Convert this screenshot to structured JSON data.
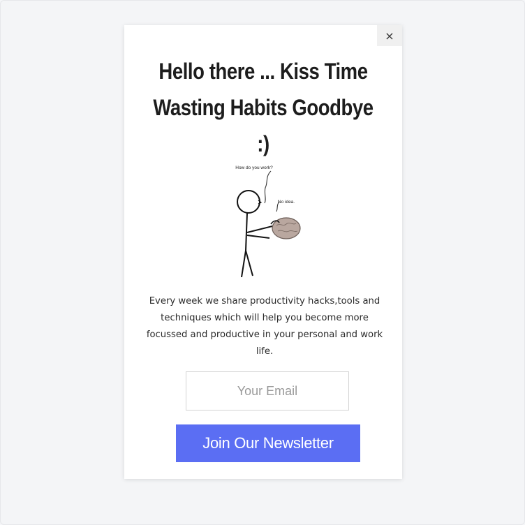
{
  "popup": {
    "close_label": "×",
    "title": "Hello there ... Kiss Time Wasting Habits Goodbye :)",
    "illustration": {
      "speech_question": "How do you work?",
      "speech_answer": "No idea."
    },
    "description": "Every week we share productivity hacks,tools and techniques which will help you become more focussed and productive in your personal and work life.",
    "email_placeholder": "Your Email",
    "join_label": "Join Our Newsletter"
  },
  "colors": {
    "button_bg": "#5b6ef3",
    "button_text": "#ffffff",
    "brain": "#b9a79f"
  }
}
